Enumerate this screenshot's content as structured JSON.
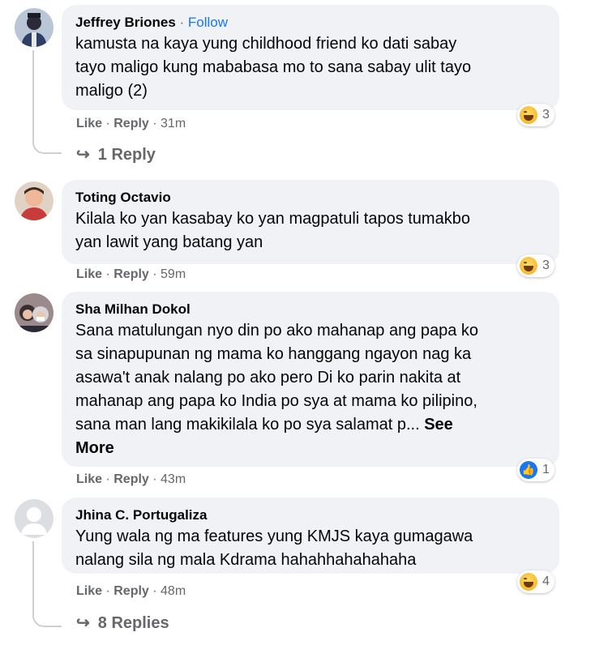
{
  "comments": [
    {
      "author": "Jeffrey Briones",
      "follow_sep": " · ",
      "follow": "Follow",
      "text": "kamusta na kaya yung childhood friend ko dati sabay\ntayo maligo kung mababasa mo to sana sabay ulit tayo\nmaligo (2)",
      "like": "Like",
      "reply": "Reply",
      "dot": " · ",
      "time": "31m",
      "reaction_icon": "haha-emoji",
      "reaction_count": "3",
      "replies_label": "1 Reply"
    },
    {
      "author": "Toting Octavio",
      "text": "Kilala ko yan kasabay ko yan magpatuli tapos tumakbo\nyan lawit yang batang yan",
      "like": "Like",
      "reply": "Reply",
      "dot": " · ",
      "time": "59m",
      "reaction_icon": "haha-emoji",
      "reaction_count": "3"
    },
    {
      "author": "Sha Milhan Dokol",
      "text": "Sana matulungan nyo din po ako mahanap ang papa ko\nsa sinapupunan ng mama ko hanggang ngayon nag ka\nasawa't anak nalang po ako pero Di ko parin nakita at\nmahanap ang papa ko India po sya at mama ko pilipino,\nsana man lang makikilala ko po sya salamat p... ",
      "see_more": "See\nMore",
      "like": "Like",
      "reply": "Reply",
      "dot": " · ",
      "time": "43m",
      "reaction_icon": "like-emoji",
      "reaction_count": "1"
    },
    {
      "author": "Jhina C. Portugaliza",
      "text": "Yung wala ng ma features yung KMJS kaya gumagawa\nnalang sila ng mala Kdrama hahahhahahahaha",
      "like": "Like",
      "reply": "Reply",
      "dot": " · ",
      "time": "48m",
      "reaction_icon": "haha-emoji",
      "reaction_count": "4",
      "replies_label": "8 Replies"
    }
  ],
  "icons": {
    "reply_arrow": "↪"
  },
  "colors": {
    "bubble": "#f0f2f5",
    "link": "#1877f2",
    "meta": "#65676b"
  }
}
